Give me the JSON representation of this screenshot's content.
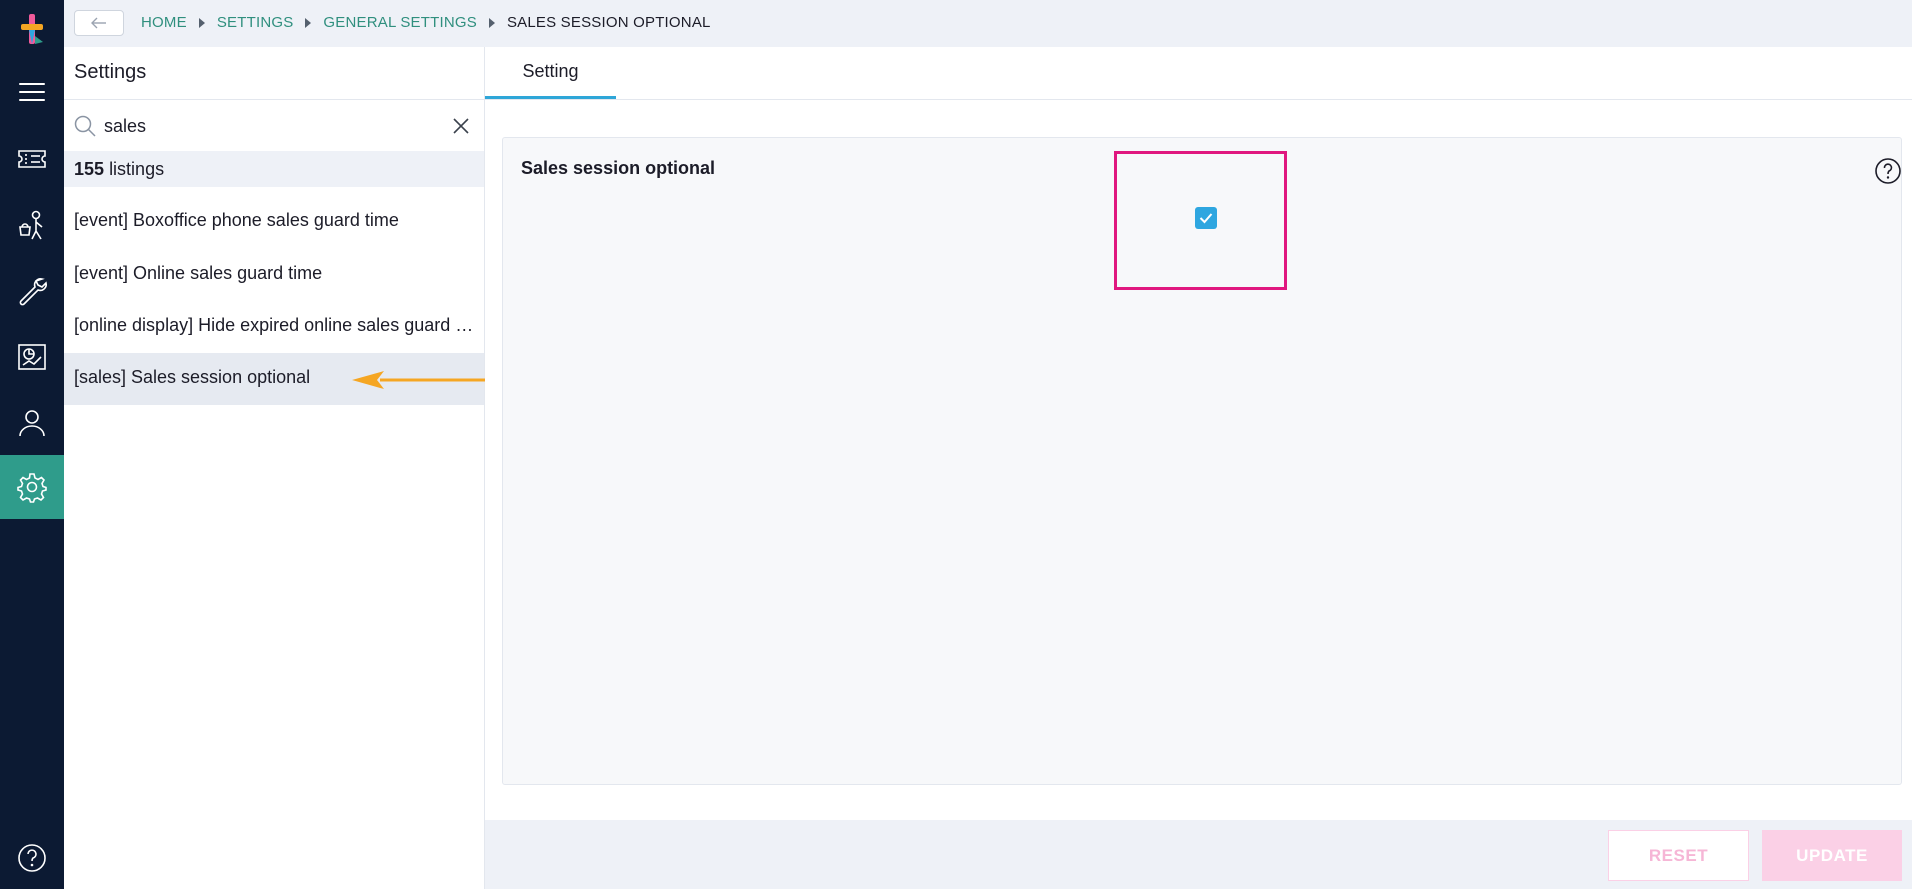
{
  "breadcrumb": {
    "home": "HOME",
    "settings": "SETTINGS",
    "general": "GENERAL SETTINGS",
    "current": "SALES SESSION OPTIONAL"
  },
  "panel": {
    "title": "Settings",
    "search_value": "sales",
    "listing_count": "155",
    "listing_suffix": "listings",
    "results": [
      "[event] Boxoffice phone sales guard time",
      "[event] Online sales guard time",
      "[online display] Hide expired online sales guard time",
      "[sales] Sales session optional"
    ]
  },
  "main": {
    "tab_label": "Setting",
    "setting_label": "Sales session optional",
    "checkbox_checked": true,
    "reset_label": "RESET",
    "update_label": "UPDATE"
  },
  "icons": {
    "rail": [
      "menu-icon",
      "ticket-icon",
      "customer-icon",
      "tools-icon",
      "reports-icon",
      "user-icon",
      "settings-icon",
      "help-icon"
    ],
    "bell": "bell-icon"
  },
  "colors": {
    "rail_bg": "#0c1a33",
    "active_teal": "#2f9c8b",
    "link_teal": "#2f8f7e",
    "accent_pink": "#e0177f",
    "checkbox_blue": "#2ea6e0",
    "arrow_orange": "#f5a623"
  }
}
